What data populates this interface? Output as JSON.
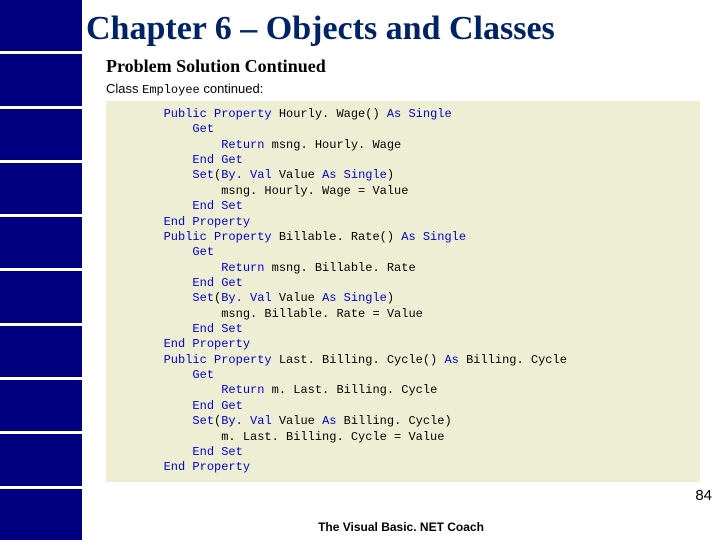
{
  "title": "Chapter 6 – Objects and Classes",
  "subtitle": "Problem Solution Continued",
  "class_prefix": "Class ",
  "class_name": "Employee",
  "class_suffix": " continued:",
  "code": {
    "lines": [
      {
        "i": 2,
        "t": [
          {
            "k": true,
            "s": "Public Property "
          },
          {
            "k": false,
            "s": "Hourly. Wage() "
          },
          {
            "k": true,
            "s": "As Single"
          }
        ]
      },
      {
        "i": 3,
        "t": [
          {
            "k": true,
            "s": "Get"
          }
        ]
      },
      {
        "i": 4,
        "t": [
          {
            "k": true,
            "s": "Return "
          },
          {
            "k": false,
            "s": "msng. Hourly. Wage"
          }
        ]
      },
      {
        "i": 3,
        "t": [
          {
            "k": true,
            "s": "End Get"
          }
        ]
      },
      {
        "i": 3,
        "t": [
          {
            "k": true,
            "s": "Set"
          },
          {
            "k": false,
            "s": "("
          },
          {
            "k": true,
            "s": "By. Val "
          },
          {
            "k": false,
            "s": "Value "
          },
          {
            "k": true,
            "s": "As Single"
          },
          {
            "k": false,
            "s": ")"
          }
        ]
      },
      {
        "i": 4,
        "t": [
          {
            "k": false,
            "s": "msng. Hourly. Wage = Value"
          }
        ]
      },
      {
        "i": 3,
        "t": [
          {
            "k": true,
            "s": "End Set"
          }
        ]
      },
      {
        "i": 2,
        "t": [
          {
            "k": true,
            "s": "End Property"
          }
        ]
      },
      {
        "i": 2,
        "t": [
          {
            "k": true,
            "s": "Public Property "
          },
          {
            "k": false,
            "s": "Billable. Rate() "
          },
          {
            "k": true,
            "s": "As Single"
          }
        ]
      },
      {
        "i": 3,
        "t": [
          {
            "k": true,
            "s": "Get"
          }
        ]
      },
      {
        "i": 4,
        "t": [
          {
            "k": true,
            "s": "Return "
          },
          {
            "k": false,
            "s": "msng. Billable. Rate"
          }
        ]
      },
      {
        "i": 3,
        "t": [
          {
            "k": true,
            "s": "End Get"
          }
        ]
      },
      {
        "i": 3,
        "t": [
          {
            "k": true,
            "s": "Set"
          },
          {
            "k": false,
            "s": "("
          },
          {
            "k": true,
            "s": "By. Val "
          },
          {
            "k": false,
            "s": "Value "
          },
          {
            "k": true,
            "s": "As Single"
          },
          {
            "k": false,
            "s": ")"
          }
        ]
      },
      {
        "i": 4,
        "t": [
          {
            "k": false,
            "s": "msng. Billable. Rate = Value"
          }
        ]
      },
      {
        "i": 3,
        "t": [
          {
            "k": true,
            "s": "End Set"
          }
        ]
      },
      {
        "i": 2,
        "t": [
          {
            "k": true,
            "s": "End Property"
          }
        ]
      },
      {
        "i": 2,
        "t": [
          {
            "k": true,
            "s": "Public Property "
          },
          {
            "k": false,
            "s": "Last. Billing. Cycle() "
          },
          {
            "k": true,
            "s": "As "
          },
          {
            "k": false,
            "s": "Billing. Cycle"
          }
        ]
      },
      {
        "i": 3,
        "t": [
          {
            "k": true,
            "s": "Get"
          }
        ]
      },
      {
        "i": 4,
        "t": [
          {
            "k": true,
            "s": "Return "
          },
          {
            "k": false,
            "s": "m. Last. Billing. Cycle"
          }
        ]
      },
      {
        "i": 3,
        "t": [
          {
            "k": true,
            "s": "End Get"
          }
        ]
      },
      {
        "i": 3,
        "t": [
          {
            "k": true,
            "s": "Set"
          },
          {
            "k": false,
            "s": "("
          },
          {
            "k": true,
            "s": "By. Val "
          },
          {
            "k": false,
            "s": "Value "
          },
          {
            "k": true,
            "s": "As "
          },
          {
            "k": false,
            "s": "Billing. Cycle)"
          }
        ]
      },
      {
        "i": 4,
        "t": [
          {
            "k": false,
            "s": "m. Last. Billing. Cycle = Value"
          }
        ]
      },
      {
        "i": 3,
        "t": [
          {
            "k": true,
            "s": "End Set"
          }
        ]
      },
      {
        "i": 2,
        "t": [
          {
            "k": true,
            "s": "End Property"
          }
        ]
      }
    ],
    "indent_unit": "    "
  },
  "footer": "The Visual Basic. NET Coach",
  "page_number": "84"
}
